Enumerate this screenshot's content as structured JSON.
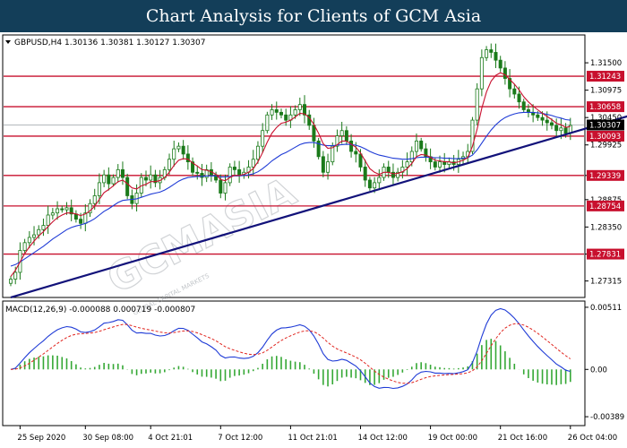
{
  "header": {
    "title": "Chart Analysis for Clients of GCM Asia"
  },
  "colors": {
    "header_bg": "#133e59",
    "level_line": "#c8102e",
    "trendline": "#12127a",
    "ma_fast": "#c8102e",
    "ma_slow": "#1f3bd6",
    "candle": "#1a7a1a",
    "macd_main": "#1f3bd6",
    "macd_signal": "#e0241e",
    "histogram": "#35a835"
  },
  "watermark": {
    "text": "GCMASIA",
    "subtext": "GLOBAL CAPITAL MARKETS"
  },
  "chart_data": [
    {
      "type": "candlestick",
      "symbol_line": "GBPUSD,H4  1.30136 1.30381 1.30127 1.30307",
      "symbol_icon": "triangle-down-icon",
      "ylim": [
        1.2705,
        1.32
      ],
      "y_ticks": [
        1.315,
        1.30975,
        1.3045,
        1.29925,
        1.29339,
        1.28875,
        1.2835,
        1.27831,
        1.27315
      ],
      "y_tick_labels": [
        "1.31500",
        "1.30975",
        "1.30450",
        "1.29925",
        "1.29339",
        "1.28875",
        "1.28350",
        "1.27831",
        "1.27315"
      ],
      "current_price": {
        "value": 1.30307,
        "label": "1.30307"
      },
      "levels": [
        {
          "value": 1.31243,
          "label": "1.31243"
        },
        {
          "value": 1.30658,
          "label": "1.30658"
        },
        {
          "value": 1.30093,
          "label": "1.30093"
        },
        {
          "value": 1.29339,
          "label": "1.29339"
        },
        {
          "value": 1.28754,
          "label": "1.28754"
        },
        {
          "value": 1.27831,
          "label": "1.27831"
        }
      ],
      "trendline": {
        "from": {
          "bar": 0,
          "price": 1.27
        },
        "to": {
          "bar": 134,
          "price": 1.3052
        }
      },
      "closes": [
        1.2735,
        1.2748,
        1.279,
        1.2805,
        1.2815,
        1.282,
        1.283,
        1.2838,
        1.2858,
        1.2862,
        1.287,
        1.2868,
        1.2872,
        1.286,
        1.285,
        1.2842,
        1.2862,
        1.288,
        1.2895,
        1.292,
        1.2935,
        1.2918,
        1.293,
        1.2945,
        1.293,
        1.2895,
        1.288,
        1.29,
        1.293,
        1.2925,
        1.2935,
        1.292,
        1.293,
        1.2945,
        1.2965,
        1.2985,
        1.299,
        1.2975,
        1.296,
        1.294,
        1.2938,
        1.293,
        1.2945,
        1.2935,
        1.2925,
        1.29,
        1.292,
        1.295,
        1.2945,
        1.2935,
        1.294,
        1.295,
        1.2965,
        1.299,
        1.302,
        1.305,
        1.306,
        1.3055,
        1.305,
        1.304,
        1.305,
        1.306,
        1.307,
        1.305,
        1.303,
        1.3,
        1.297,
        1.294,
        1.296,
        1.299,
        1.301,
        1.302,
        1.3,
        1.298,
        1.2975,
        1.295,
        1.2925,
        1.291,
        1.292,
        1.293,
        1.295,
        1.294,
        1.293,
        1.294,
        1.295,
        1.296,
        1.298,
        1.3,
        1.2985,
        1.297,
        1.296,
        1.295,
        1.296,
        1.2955,
        1.296,
        1.2955,
        1.2965,
        1.297,
        1.298,
        1.304,
        1.31,
        1.316,
        1.3175,
        1.317,
        1.3155,
        1.314,
        1.312,
        1.31,
        1.309,
        1.3075,
        1.306,
        1.3055,
        1.305,
        1.3045,
        1.304,
        1.3035,
        1.303,
        1.302,
        1.3025,
        1.3015,
        1.303
      ],
      "ma_fast": [
        1.274,
        1.2752,
        1.2768,
        1.2784,
        1.2797,
        1.2808,
        1.2818,
        1.2826,
        1.2836,
        1.2845,
        1.2853,
        1.2858,
        1.2862,
        1.2862,
        1.286,
        1.2857,
        1.286,
        1.2866,
        1.2875,
        1.2888,
        1.2901,
        1.2907,
        1.2914,
        1.2922,
        1.2925,
        1.2918,
        1.291,
        1.2908,
        1.2914,
        1.2917,
        1.2922,
        1.2922,
        1.2924,
        1.293,
        1.294,
        1.2953,
        1.2963,
        1.2966,
        1.2965,
        1.2958,
        1.2952,
        1.2945,
        1.2944,
        1.2941,
        1.2936,
        1.2926,
        1.2924,
        1.293,
        1.2934,
        1.2934,
        1.2936,
        1.294,
        1.2947,
        1.296,
        1.2978,
        1.2998,
        1.3015,
        1.3026,
        1.3034,
        1.3036,
        1.304,
        1.3046,
        1.3053,
        1.3052,
        1.3045,
        1.3032,
        1.3015,
        1.2995,
        1.2986,
        1.2987,
        1.2993,
        1.3,
        1.3,
        1.2994,
        1.2988,
        1.2977,
        1.2962,
        1.2947,
        1.294,
        1.2936,
        1.294,
        1.294,
        1.2937,
        1.2938,
        1.2941,
        1.2947,
        1.2957,
        1.297,
        1.2974,
        1.2973,
        1.2969,
        1.2963,
        1.2962,
        1.296,
        1.296,
        1.2958,
        1.296,
        1.2963,
        1.2968,
        1.299,
        1.3023,
        1.3063,
        1.3094,
        1.3115,
        1.3126,
        1.3131,
        1.3127,
        1.3118,
        1.3109,
        1.3098,
        1.3085,
        1.3075,
        1.3067,
        1.306,
        1.3053,
        1.3047,
        1.3041,
        1.3034,
        1.3031,
        1.3026,
        1.3028
      ],
      "ma_slow": [
        1.276,
        1.2763,
        1.2768,
        1.2774,
        1.278,
        1.2786,
        1.2792,
        1.2798,
        1.2805,
        1.2812,
        1.2818,
        1.2824,
        1.283,
        1.2834,
        1.2837,
        1.2839,
        1.2842,
        1.2846,
        1.2851,
        1.2858,
        1.2865,
        1.287,
        1.2876,
        1.2882,
        1.2886,
        1.2887,
        1.2888,
        1.2889,
        1.2892,
        1.2895,
        1.2898,
        1.29,
        1.2902,
        1.2906,
        1.2911,
        1.2917,
        1.2923,
        1.2927,
        1.293,
        1.2931,
        1.2932,
        1.2932,
        1.2933,
        1.2933,
        1.2933,
        1.2931,
        1.2931,
        1.2932,
        1.2933,
        1.2933,
        1.2934,
        1.2935,
        1.2937,
        1.2941,
        1.2947,
        1.2954,
        1.2962,
        1.2968,
        1.2974,
        1.2978,
        1.2983,
        1.2988,
        1.2993,
        1.2996,
        1.2997,
        1.2997,
        1.2995,
        1.2992,
        1.2991,
        1.2991,
        1.2992,
        1.2993,
        1.2994,
        1.2993,
        1.2992,
        1.2989,
        1.2985,
        1.298,
        1.2976,
        1.2973,
        1.2971,
        1.2969,
        1.2967,
        1.2966,
        1.2965,
        1.2965,
        1.2966,
        1.2968,
        1.2969,
        1.2969,
        1.2969,
        1.2968,
        1.2968,
        1.2967,
        1.2967,
        1.2966,
        1.2966,
        1.2967,
        1.2968,
        1.2973,
        1.2983,
        1.2996,
        1.3009,
        1.3021,
        1.3031,
        1.3039,
        1.3045,
        1.3049,
        1.3052,
        1.3054,
        1.3055,
        1.3055,
        1.3055,
        1.3054,
        1.3053,
        1.3051,
        1.3049,
        1.3046,
        1.3044,
        1.3041,
        1.304
      ]
    },
    {
      "type": "macd",
      "label": "MACD(12,26,9) -0.000088 0.000719 -0.000807",
      "ylim": [
        -0.0044,
        0.0054
      ],
      "y_ticks": [
        0.00511,
        0.0,
        -0.00389
      ],
      "y_tick_labels": [
        "0.00511",
        "0.00",
        "-0.00389"
      ],
      "x_tick_labels": [
        "25 Sep 2020",
        "30 Sep 08:00",
        "4 Oct 21:01",
        "7 Oct 12:00",
        "11 Oct 21:01",
        "14 Oct 12:00",
        "19 Oct 00:00",
        "21 Oct 16:00",
        "26 Oct 04:00"
      ],
      "x_tick_bars": [
        2,
        16,
        30,
        45,
        60,
        75,
        90,
        105,
        120
      ]
    }
  ]
}
